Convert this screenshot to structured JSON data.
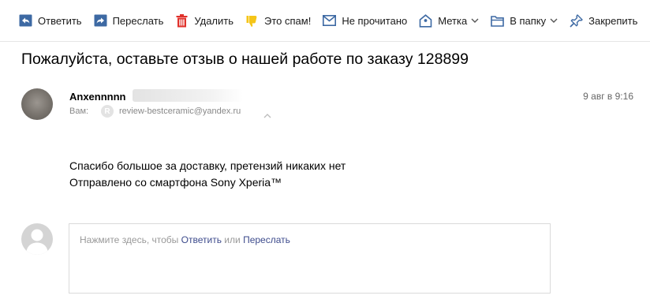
{
  "toolbar": {
    "reply": "Ответить",
    "forward": "Переслать",
    "delete": "Удалить",
    "spam": "Это спам!",
    "unread": "Не прочитано",
    "label": "Метка",
    "folder": "В папку",
    "pin": "Закрепить"
  },
  "message": {
    "subject": "Пожалуйста, оставьте отзыв о нашей работе по заказу 128899",
    "sender_name": "Anxennnnn",
    "to_label": "Вам:",
    "to_badge": "R",
    "to_email": "review-bestceramic@yandex.ru",
    "date": "9 авг в 9:16",
    "body_lines": [
      "Спасибо большое за доставку, претензий никаких нет",
      "Отправлено со смартфона Sony Xperia™"
    ]
  },
  "reply": {
    "hint_prefix": "Нажмите здесь, чтобы",
    "reply_link": "Ответить",
    "or": "или",
    "forward_link": "Переслать"
  },
  "colors": {
    "icon_blue": "#3d69a3",
    "delete_red": "#e0312b",
    "spam_yellow": "#f5c518",
    "link": "#3d4b8c"
  }
}
